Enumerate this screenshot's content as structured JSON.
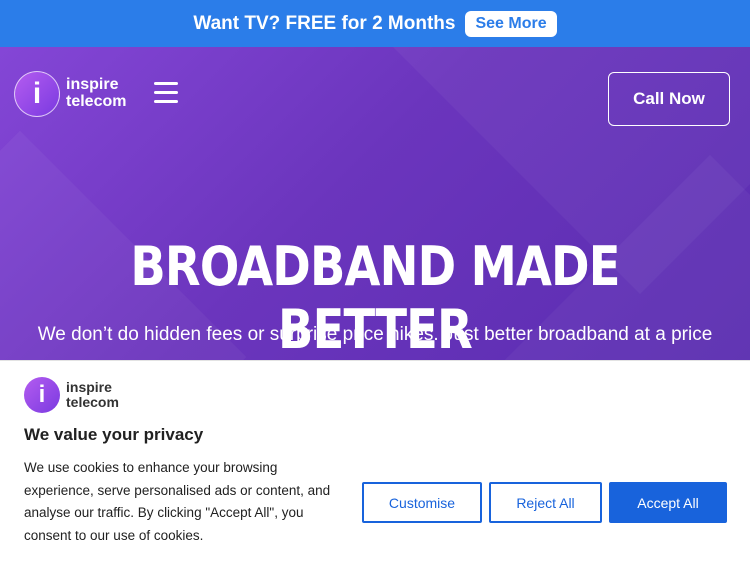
{
  "promo": {
    "text": "Want TV? FREE for 2 Months",
    "button": "See More"
  },
  "header": {
    "logo_mark": "i",
    "logo_line1": "inspire",
    "logo_line2": "telecom",
    "menu_icon": "hamburger-menu-icon",
    "call_button": "Call Now"
  },
  "hero": {
    "title": "BROADBAND MADE BETTER",
    "subtitle": "We don’t do hidden fees or surprise price hikes. Just better broadband at a price"
  },
  "cookie": {
    "logo_mark": "i",
    "logo_line1": "inspire",
    "logo_line2": "telecom",
    "title": "We value your privacy",
    "text": "We use cookies to enhance your browsing experience, serve personalised ads or content, and analyse our traffic. By clicking \"Accept All\", you consent to our use of cookies.",
    "customise_label": "Customise",
    "reject_label": "Reject All",
    "accept_label": "Accept All"
  },
  "colors": {
    "promo_bg": "#2b7de9",
    "hero_bg": "#6b35bd",
    "accent_blue": "#1863dc"
  }
}
